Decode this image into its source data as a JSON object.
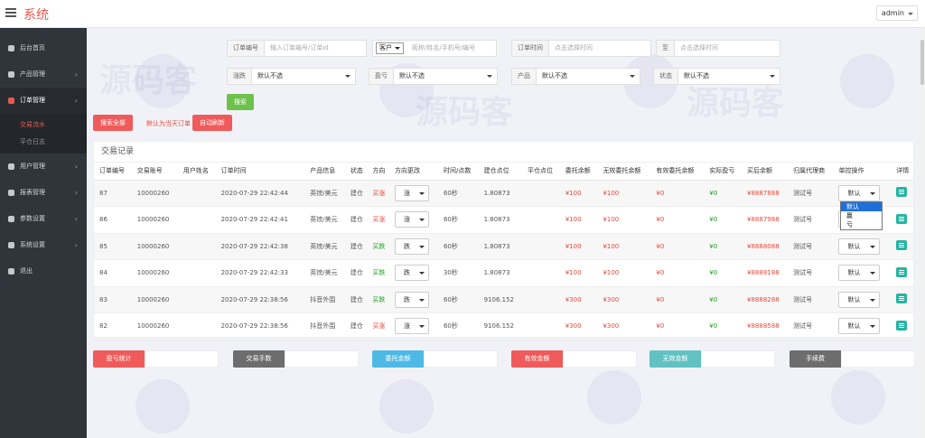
{
  "app": {
    "title": "系统",
    "user": "admin"
  },
  "sidebar": {
    "items": [
      {
        "label": "后台首页",
        "icon": "dashboard-icon"
      },
      {
        "label": "产品管理",
        "icon": "bitcoin-icon"
      },
      {
        "label": "订单管理",
        "icon": "copy-icon",
        "active": true
      },
      {
        "label": "用户管理",
        "icon": "user-icon"
      },
      {
        "label": "报表管理",
        "icon": "chart-icon"
      },
      {
        "label": "参数设置",
        "icon": "gear-icon"
      },
      {
        "label": "系统设置",
        "icon": "gears-icon"
      },
      {
        "label": "退出",
        "icon": "logout-icon"
      }
    ],
    "subitems": [
      "交易流水",
      "平仓日志"
    ]
  },
  "filters": {
    "order_no": {
      "label": "订单编号",
      "placeholder": "输入订单编号/订单id"
    },
    "account": {
      "select": "客户",
      "placeholder": "昵称/姓名/手机号/编号"
    },
    "order_time": {
      "label": "订单时间",
      "placeholder": "点击选择时间"
    },
    "to": {
      "label": "至",
      "placeholder": "点击选择时间"
    },
    "kind": {
      "label": "涨跌",
      "value": "默认不选"
    },
    "pnl": {
      "label": "盈亏",
      "value": "默认不选"
    },
    "product": {
      "label": "产品",
      "value": "默认不选"
    },
    "status": {
      "label": "状态",
      "value": "默认不选"
    },
    "search": "搜索",
    "search_all": "搜索全部",
    "today_hint": "默认为当天订单",
    "auto_refresh": "自动刷新"
  },
  "table": {
    "title": "交易记录",
    "headers": [
      "订单编号",
      "交易账号",
      "用户姓名",
      "订单时间",
      "产品信息",
      "状态",
      "方向",
      "方向更改",
      "时间/点数",
      "建仓点位",
      "平仓点位",
      "委托余额",
      "无效委托余额",
      "有效委托余额",
      "实际盈亏",
      "买后余额",
      "归属代理商",
      "单控操作",
      "详情"
    ],
    "rows": [
      {
        "id": "87",
        "acct": "10000260",
        "name": "",
        "time": "2020-07-29 22:42:44",
        "product": "英镑/美元",
        "status": "建仓",
        "dir": "买涨",
        "change": "涨",
        "period": "60秒",
        "open": "1.80873",
        "close": "",
        "amt": "¥100",
        "invalid": "¥100",
        "valid": "¥0",
        "pnl": "¥0",
        "after": "¥8887888",
        "agent": "测试号",
        "op": "默认"
      },
      {
        "id": "86",
        "acct": "10000260",
        "name": "",
        "time": "2020-07-29 22:42:41",
        "product": "英镑/美元",
        "status": "建仓",
        "dir": "买涨",
        "change": "涨",
        "period": "60秒",
        "open": "1.80873",
        "close": "",
        "amt": "¥100",
        "invalid": "¥100",
        "valid": "¥0",
        "pnl": "¥0",
        "after": "¥8887988",
        "agent": "测试号",
        "op": "默认"
      },
      {
        "id": "85",
        "acct": "10000260",
        "name": "",
        "time": "2020-07-29 22:42:38",
        "product": "英镑/美元",
        "status": "建仓",
        "dir": "买跌",
        "change": "跌",
        "period": "60秒",
        "open": "1.80873",
        "close": "",
        "amt": "¥100",
        "invalid": "¥100",
        "valid": "¥0",
        "pnl": "¥0",
        "after": "¥8888088",
        "agent": "测试号",
        "op": "默认"
      },
      {
        "id": "84",
        "acct": "10000260",
        "name": "",
        "time": "2020-07-29 22:42:33",
        "product": "英镑/美元",
        "status": "建仓",
        "dir": "买跌",
        "change": "跌",
        "period": "30秒",
        "open": "1.80873",
        "close": "",
        "amt": "¥100",
        "invalid": "¥100",
        "valid": "¥0",
        "pnl": "¥0",
        "after": "¥8888188",
        "agent": "测试号",
        "op": "默认"
      },
      {
        "id": "83",
        "acct": "10000260",
        "name": "",
        "time": "2020-07-29 22:38:56",
        "product": "抖音外围",
        "status": "建仓",
        "dir": "买跌",
        "change": "跌",
        "period": "60秒",
        "open": "9106.152",
        "close": "",
        "amt": "¥300",
        "invalid": "¥300",
        "valid": "¥0",
        "pnl": "¥0",
        "after": "¥8888288",
        "agent": "测试号",
        "op": "默认"
      },
      {
        "id": "82",
        "acct": "10000260",
        "name": "",
        "time": "2020-07-29 22:38:56",
        "product": "抖音外围",
        "status": "建仓",
        "dir": "买涨",
        "change": "涨",
        "period": "60秒",
        "open": "9106.152",
        "close": "",
        "amt": "¥300",
        "invalid": "¥300",
        "valid": "¥0",
        "pnl": "¥0",
        "after": "¥8888588",
        "agent": "测试号",
        "op": "默认"
      }
    ],
    "dropdown_options": [
      "默认",
      "赢",
      "亏"
    ]
  },
  "summary": [
    {
      "label": "盈亏统计",
      "value": "",
      "color": "#ef5b5b"
    },
    {
      "label": "交易手数",
      "value": "",
      "color": "#6d6d6d"
    },
    {
      "label": "委托金额",
      "value": "",
      "color": "#4fb9e6"
    },
    {
      "label": "有效金额",
      "value": "",
      "color": "#ef5b5b"
    },
    {
      "label": "无效金额",
      "value": "",
      "color": "#62c2c2"
    },
    {
      "label": "手续费",
      "value": "",
      "color": "#6d6d6d"
    }
  ],
  "watermark": "源码客"
}
